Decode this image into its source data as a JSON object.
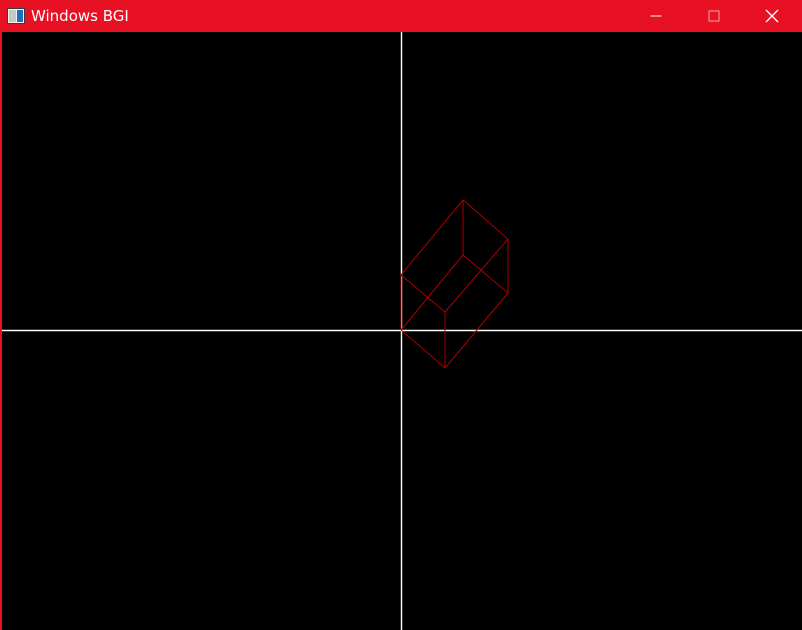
{
  "window": {
    "title": "Windows BGI",
    "app_icon": "bgi-app-icon",
    "accent_color": "#E81123",
    "background_color": "#000000",
    "controls": {
      "minimize_icon": "minimize-icon",
      "maximize_icon": "maximize-icon",
      "maximize_enabled": false,
      "close_icon": "close-icon"
    }
  },
  "canvas": {
    "background_color": "#000000",
    "axes_color": "#FFFFFF",
    "shape_color": "#A80000",
    "shape": "wireframe-cuboid"
  }
}
